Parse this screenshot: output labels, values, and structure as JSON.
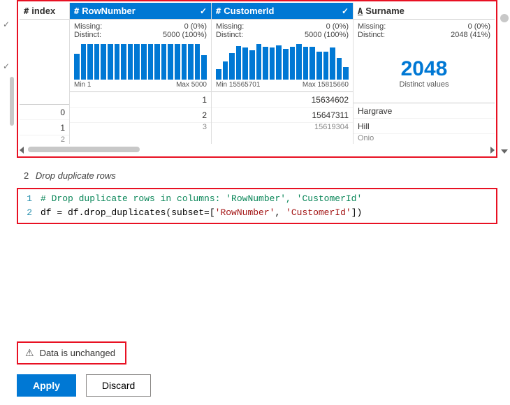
{
  "grid": {
    "columns": {
      "index": {
        "icon": "#",
        "label": "index",
        "selected": false
      },
      "rownumber": {
        "icon": "#",
        "label": "RowNumber",
        "selected": true,
        "missing_label": "Missing:",
        "missing_value": "0 (0%)",
        "distinct_label": "Distinct:",
        "distinct_value": "5000 (100%)",
        "min_label": "Min 1",
        "max_label": "Max 5000"
      },
      "customerid": {
        "icon": "#",
        "label": "CustomerId",
        "selected": true,
        "missing_label": "Missing:",
        "missing_value": "0 (0%)",
        "distinct_label": "Distinct:",
        "distinct_value": "5000 (100%)",
        "min_label": "Min 15565701",
        "max_label": "Max 15815660"
      },
      "surname": {
        "icon": "A̲",
        "label": "Surname",
        "selected": false,
        "missing_label": "Missing:",
        "missing_value": "0 (0%)",
        "distinct_label": "Distinct:",
        "distinct_value": "2048 (41%)",
        "big_number": "2048",
        "big_label": "Distinct values"
      }
    },
    "rows": [
      {
        "index": "0",
        "rownumber": "1",
        "customerid": "15634602",
        "surname": "Hargrave"
      },
      {
        "index": "1",
        "rownumber": "2",
        "customerid": "15647311",
        "surname": "Hill"
      },
      {
        "index": "2",
        "rownumber": "3",
        "customerid": "15619304",
        "surname": "Onio"
      }
    ]
  },
  "chart_data": [
    {
      "type": "bar",
      "column": "RowNumber",
      "xlabel": "",
      "ylabel": "",
      "xrange": [
        1,
        5000
      ],
      "heights_pct": [
        72,
        98,
        98,
        98,
        98,
        98,
        98,
        98,
        98,
        98,
        98,
        98,
        98,
        98,
        98,
        98,
        98,
        98,
        98,
        68
      ],
      "note": "approximately flat histogram; first & last bin slightly shorter"
    },
    {
      "type": "bar",
      "column": "CustomerId",
      "xlabel": "",
      "ylabel": "",
      "xrange": [
        15565701,
        15815660
      ],
      "heights_pct": [
        28,
        50,
        74,
        92,
        88,
        80,
        98,
        90,
        88,
        94,
        84,
        90,
        98,
        90,
        90,
        76,
        76,
        88,
        60,
        34
      ],
      "note": "roughly bell-shaped histogram"
    }
  ],
  "step": {
    "number": "2",
    "title": "Drop duplicate rows"
  },
  "code": {
    "line1": {
      "num": "1",
      "comment": "# Drop duplicate rows in columns: 'RowNumber', 'CustomerId'"
    },
    "line2": {
      "num": "2",
      "pre": "df = df.drop_duplicates(subset=[",
      "s1": "'RowNumber'",
      "sep": ", ",
      "s2": "'CustomerId'",
      "post": "])"
    }
  },
  "status": {
    "text": "Data is unchanged"
  },
  "buttons": {
    "apply": "Apply",
    "discard": "Discard"
  }
}
